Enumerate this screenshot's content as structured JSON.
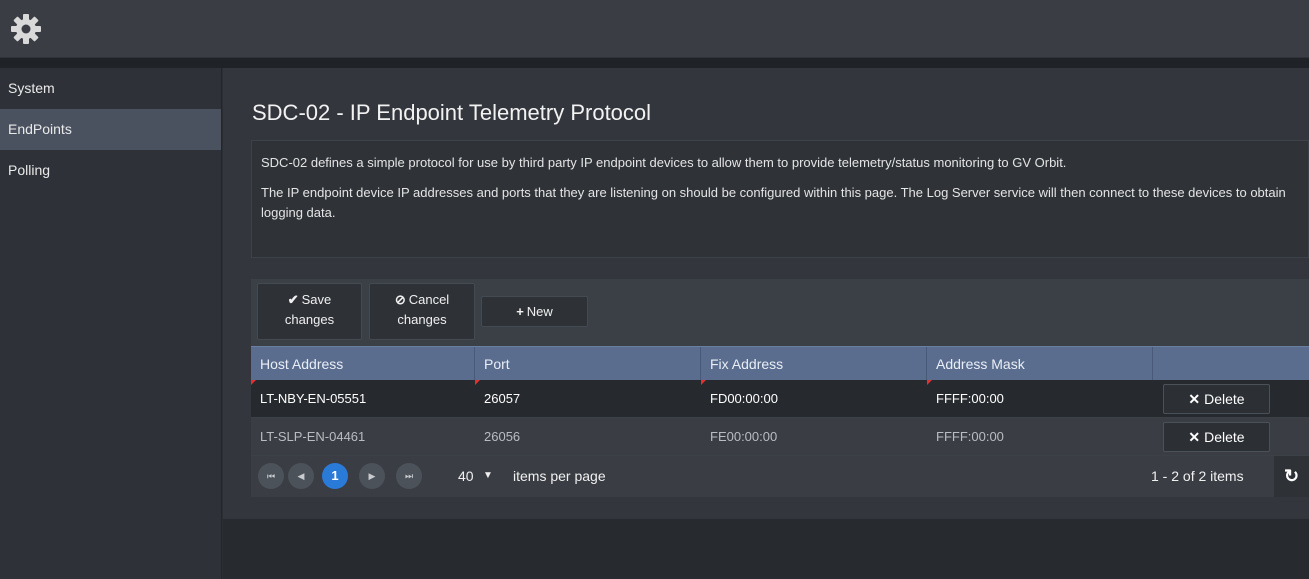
{
  "header": {
    "icon": "gear-icon"
  },
  "sidebar": {
    "items": [
      {
        "label": "System"
      },
      {
        "label": "EndPoints"
      },
      {
        "label": "Polling"
      }
    ],
    "active": "EndPoints"
  },
  "page": {
    "title": "SDC-02 - IP Endpoint Telemetry Protocol",
    "desc1": "SDC-02 defines a simple protocol for use by third party IP endpoint devices to allow them to provide telemetry/status monitoring to GV Orbit.",
    "desc2": "The IP endpoint device IP addresses and ports that they are listening on should be configured within this page. The Log Server service will then connect to these devices to obtain logging data."
  },
  "toolbar": {
    "save_line1": "Save",
    "save_line2": "changes",
    "cancel_line1": "Cancel",
    "cancel_line2": "changes",
    "new_label": "New"
  },
  "table": {
    "columns": [
      "Host Address",
      "Port",
      "Fix Address",
      "Address Mask"
    ],
    "rows": [
      {
        "host": "LT-NBY-EN-05551",
        "port": "26057",
        "fix": "FD00:00:00",
        "mask": "FFFF:00:00",
        "action": "Delete"
      },
      {
        "host": "LT-SLP-EN-04461",
        "port": "26056",
        "fix": "FE00:00:00",
        "mask": "FFFF:00:00",
        "action": "Delete"
      }
    ]
  },
  "pager": {
    "current_page": "1",
    "page_size": "40",
    "page_size_label": "items per page",
    "info": "1 - 2 of 2 items"
  },
  "colors": {
    "accent": "#2a7ad8",
    "header_bg": "#5a6d8f",
    "dirty_marker": "#e53030"
  }
}
